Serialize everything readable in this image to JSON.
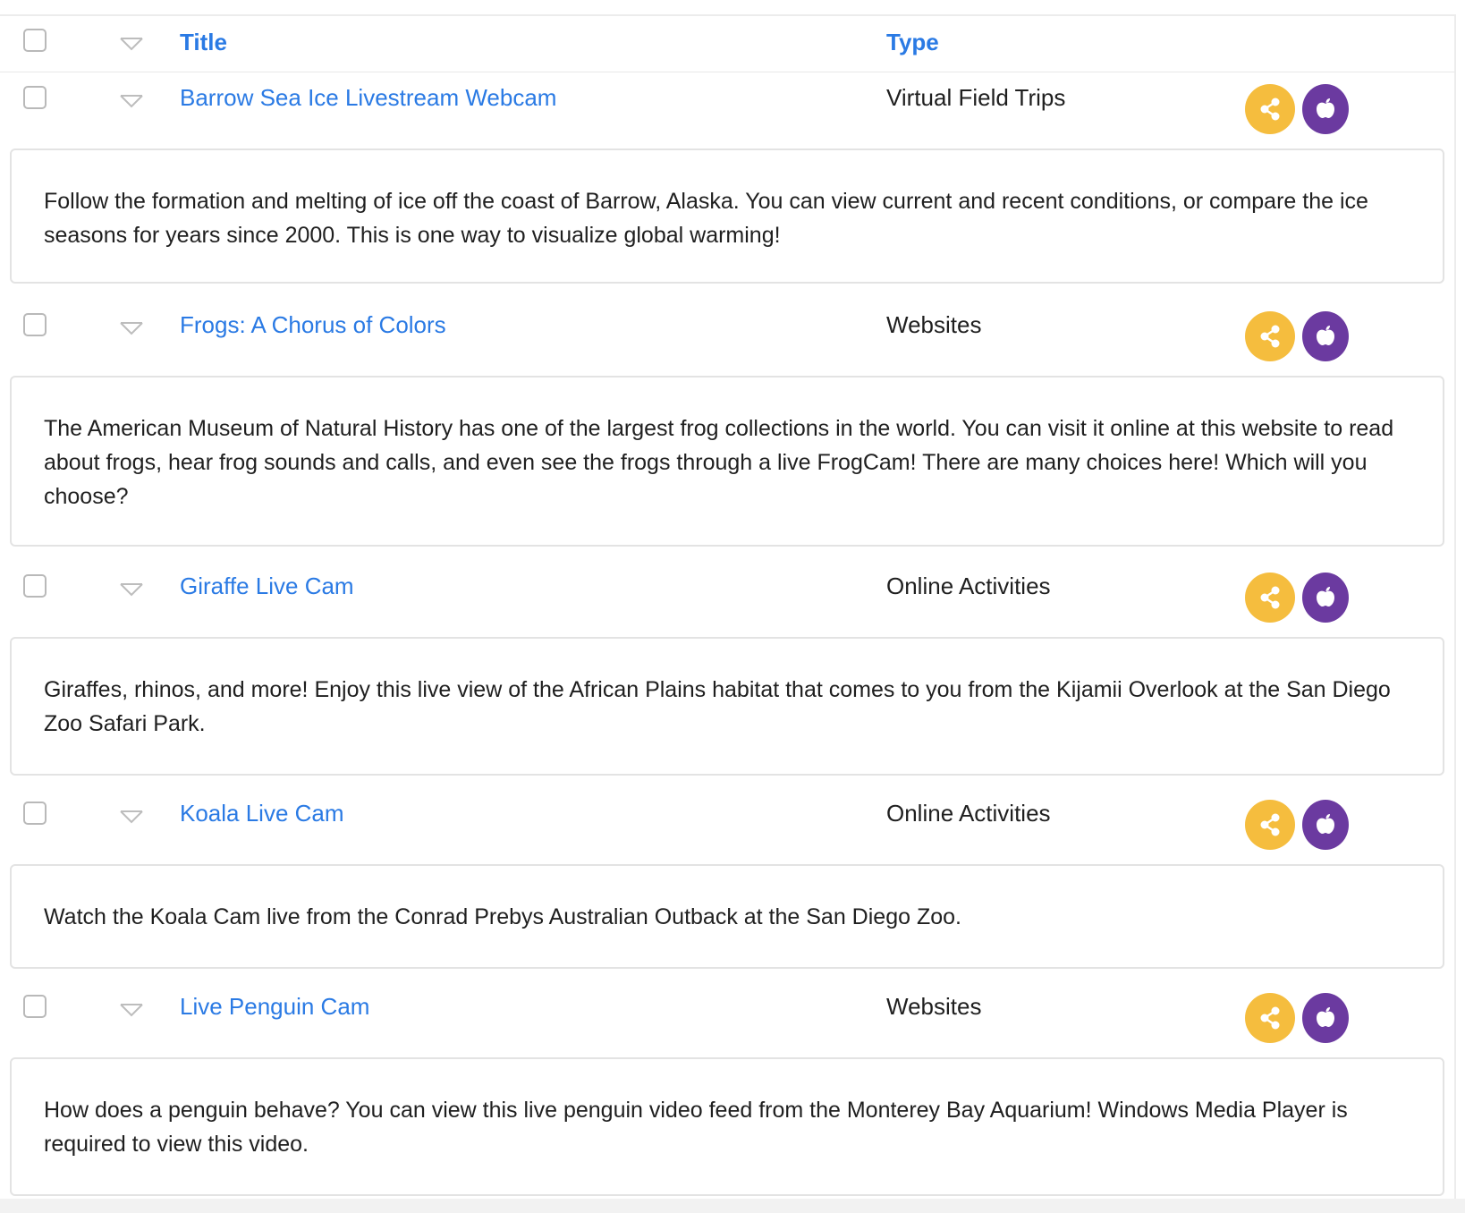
{
  "header": {
    "title_label": "Title",
    "type_label": "Type"
  },
  "colors": {
    "link": "#2a7ae4",
    "share_button": "#f5bd3e",
    "apple_button": "#6b3aa0"
  },
  "icons": {
    "share": "share-icon",
    "apple": "apple-icon",
    "expand": "caret-down-icon"
  },
  "items": [
    {
      "title": "Barrow Sea Ice Livestream Webcam",
      "type": "Virtual Field Trips",
      "description": "Follow the formation and melting of ice off the coast of Barrow, Alaska. You can view current and recent conditions, or compare the ice seasons for years since 2000. This is one way to visualize global warming!"
    },
    {
      "title": "Frogs: A Chorus of Colors",
      "type": "Websites",
      "description": "The American Museum of Natural History has one of the largest frog collections in the world. You can visit it online at this website to read about frogs, hear frog sounds and calls, and even see the frogs through a live FrogCam! There are many choices here! Which will you choose?"
    },
    {
      "title": "Giraffe Live Cam",
      "type": "Online Activities",
      "description": "Giraffes, rhinos, and more! Enjoy this live view of the African Plains habitat that comes to you from the Kijamii Overlook at the San Diego Zoo Safari Park."
    },
    {
      "title": "Koala Live Cam",
      "type": "Online Activities",
      "description": "Watch the Koala Cam live from the Conrad Prebys Australian Outback at the San Diego Zoo."
    },
    {
      "title": "Live Penguin Cam",
      "type": "Websites",
      "description": "How does a penguin behave? You can view this live penguin video feed from the Monterey Bay Aquarium! Windows Media Player is required to view this video."
    }
  ]
}
